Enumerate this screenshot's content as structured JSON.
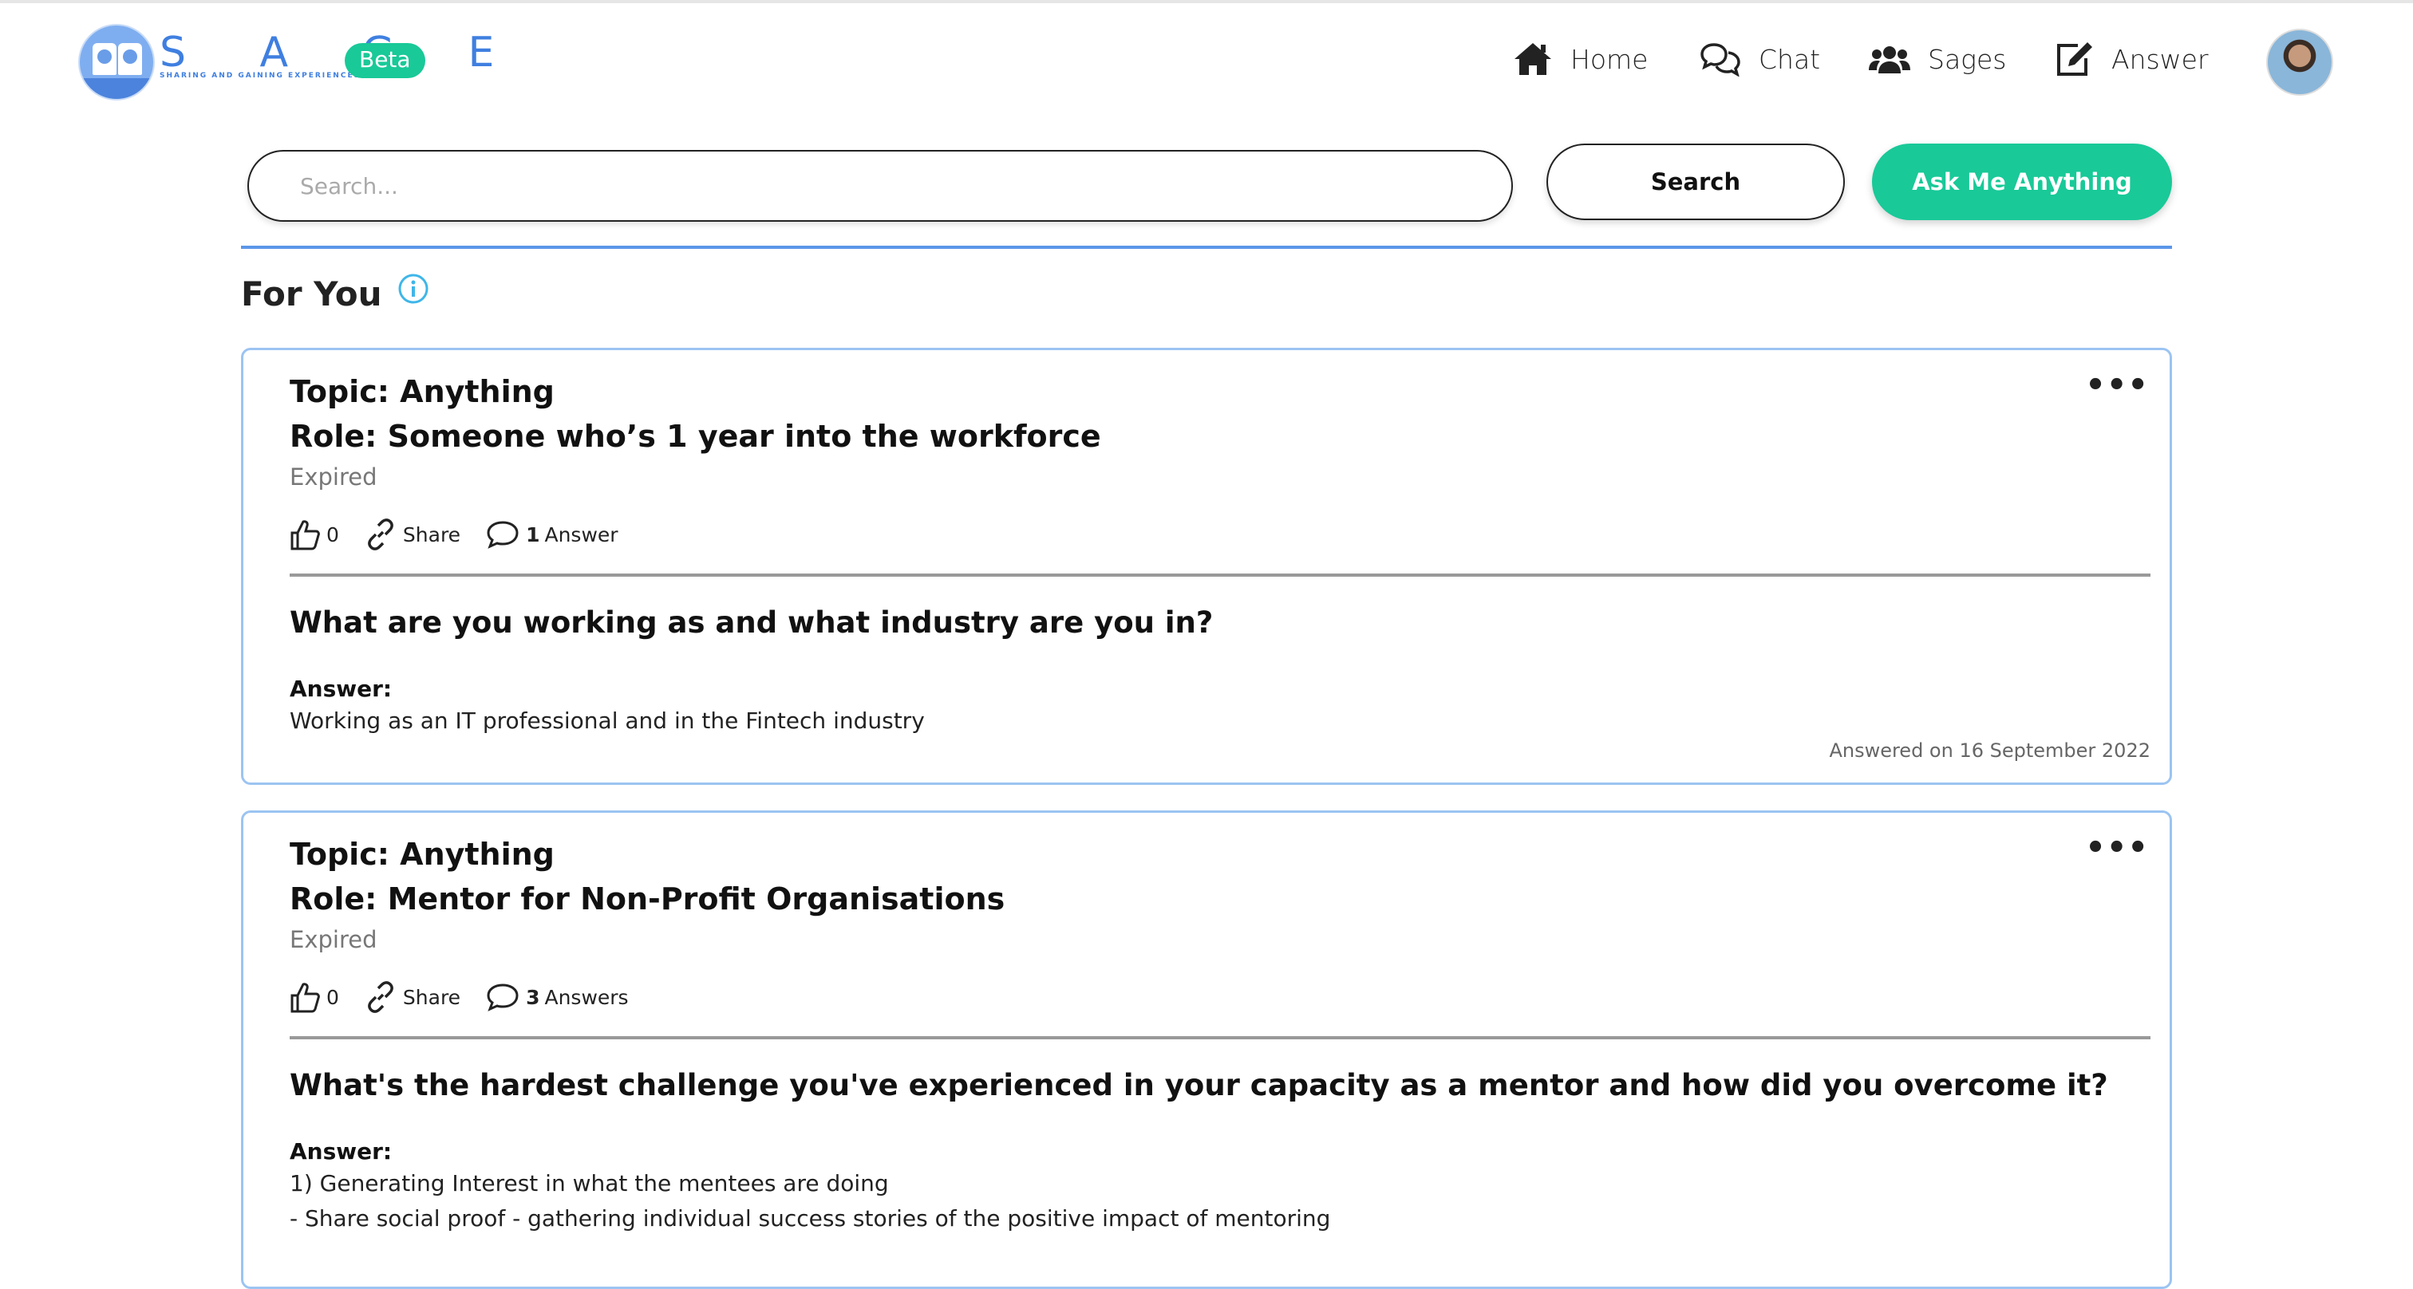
{
  "app": {
    "brand": "S A G E",
    "tagline": "SHARING AND GAINING EXPERIENCES",
    "beta_label": "Beta"
  },
  "nav": {
    "home": "Home",
    "chat": "Chat",
    "sages": "Sages",
    "answer": "Answer"
  },
  "search": {
    "placeholder": "Search...",
    "button_label": "Search",
    "ask_label": "Ask Me Anything"
  },
  "feed": {
    "title": "For You",
    "cards": [
      {
        "topic": "Topic: Anything",
        "role": "Role: Someone who’s 1 year into the workforce",
        "status": "Expired",
        "likes": "0",
        "share_label": "Share",
        "answer_count": "1",
        "answer_count_label": "Answer",
        "question": "What are you working as and what industry are you in?",
        "answer_label": "Answer:",
        "answer_text": "Working as an IT professional and in the Fintech industry",
        "answered_on": "Answered on 16 September 2022"
      },
      {
        "topic": "Topic: Anything",
        "role": "Role: Mentor for Non-Profit Organisations",
        "status": "Expired",
        "likes": "0",
        "share_label": "Share",
        "answer_count": "3",
        "answer_count_label": "Answers",
        "question": "What's the hardest challenge you've experienced in your capacity as a mentor and how did you overcome it?",
        "answer_label": "Answer:",
        "answer_text": "1) Generating Interest in what the mentees are doing",
        "answer_text_2": "- Share social proof - gathering individual success stories of the positive impact of mentoring"
      }
    ]
  },
  "colors": {
    "brand_blue": "#3f7fe0",
    "accent_green": "#19c998",
    "card_border": "#9cc4f2",
    "divider_blue": "#5b96e8"
  },
  "icons": {
    "home": "home-icon",
    "chat": "chat-bubbles-icon",
    "sages": "users-icon",
    "answer": "edit-icon",
    "info": "info-icon",
    "like": "thumbs-up-icon",
    "share": "link-icon",
    "answers": "comment-icon",
    "more": "ellipsis-icon"
  }
}
